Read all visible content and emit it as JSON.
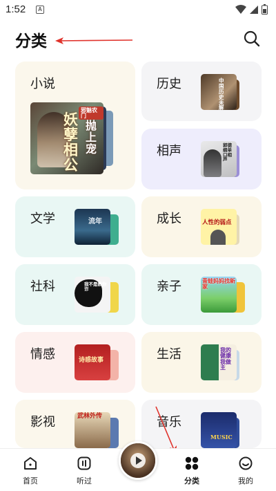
{
  "status": {
    "time": "1:52",
    "a_icon": "A"
  },
  "header": {
    "title": "分类"
  },
  "categories": [
    {
      "label": "小说",
      "bg": "#fbf7ec",
      "cover_title": "妖孽相公",
      "cover_sub": "抛上宠",
      "cover_tag": "邪魅农门"
    },
    {
      "label": "历史",
      "bg": "#f4f4f6",
      "cover_title": "中国历史未解之谜"
    },
    {
      "label": "相声",
      "bg": "#eeedfc",
      "cover_title": "郭德纲单口相声"
    },
    {
      "label": "文学",
      "bg": "#e9f7f4",
      "cover_title": "流年"
    },
    {
      "label": "成长",
      "bg": "#fbf6e8",
      "cover_title": "人性的弱点"
    },
    {
      "label": "社科",
      "bg": "#e9f7f4",
      "cover_title": "我不是教你诈"
    },
    {
      "label": "亲子",
      "bg": "#e9f7f4",
      "cover_title": "青蛙妈妈找新家"
    },
    {
      "label": "情感",
      "bg": "#fdf0ee",
      "cover_title": "诗感故事"
    },
    {
      "label": "生活",
      "bg": "#fbf6e8",
      "cover_title": "我的健康我做主"
    },
    {
      "label": "影视",
      "bg": "#fbf7ec",
      "cover_title": "武林外传"
    },
    {
      "label": "音乐",
      "bg": "#f4f4f6",
      "cover_title": "MUSIC"
    }
  ],
  "nav": {
    "home": "首页",
    "history": "听过",
    "category": "分类",
    "mine": "我的"
  },
  "colors": {
    "accent": "#e0322b",
    "arrow": "#e0322b"
  }
}
